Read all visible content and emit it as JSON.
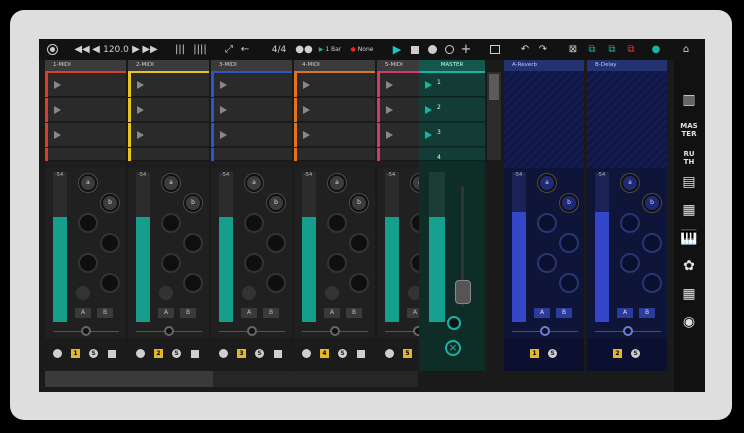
{
  "transport": {
    "tempo": "120.0",
    "time_signature": "4/4",
    "quantize": "1 Bar",
    "rec_mode": "None"
  },
  "tracks": [
    {
      "name": "1-MIDI",
      "color": "#d9402b",
      "num": "1",
      "meter": 0.7
    },
    {
      "name": "2-MIDI",
      "color": "#e6c51e",
      "num": "2",
      "meter": 0.7
    },
    {
      "name": "3-MIDI",
      "color": "#2a57c9",
      "num": "3",
      "meter": 0.7
    },
    {
      "name": "4-MIDI",
      "color": "#e3741f",
      "num": "4",
      "meter": 0.7
    },
    {
      "name": "5-MIDI",
      "color": "#d33a6b",
      "num": "5",
      "meter": 0.7
    }
  ],
  "master": {
    "name": "MASTER",
    "scenes": [
      "1",
      "2",
      "3",
      "4"
    ]
  },
  "returns": [
    {
      "name": "A-Reverb",
      "num": "1"
    },
    {
      "name": "B-Delay",
      "num": "2"
    }
  ],
  "send_labels": {
    "a": "a",
    "b": "b"
  },
  "ab": {
    "a": "A",
    "b": "B"
  },
  "solo": "S",
  "meter_top": "-54",
  "sidebar": [
    "MAS TER",
    "RU TH"
  ],
  "colors": {
    "accent": "#19b3a3",
    "return_bg": "#11184a"
  }
}
